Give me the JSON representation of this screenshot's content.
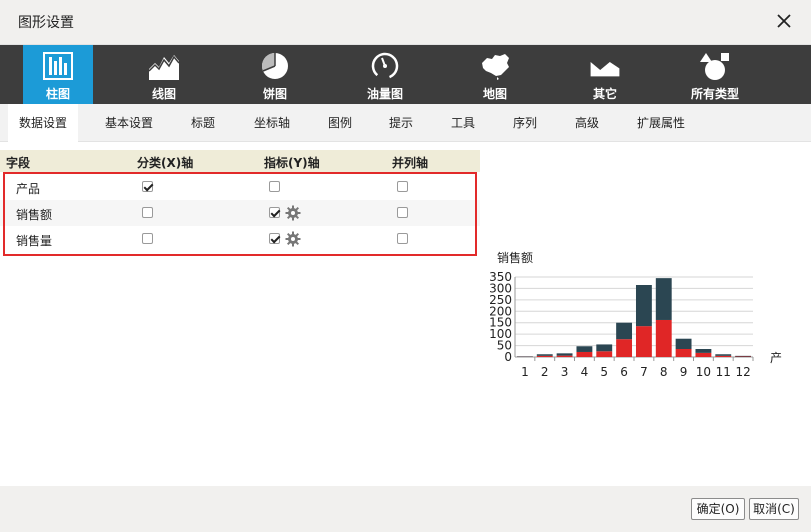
{
  "dialog": {
    "title": "图形设置"
  },
  "chart_types": [
    {
      "label": "柱图",
      "icon": "bar-chart-icon",
      "active": true
    },
    {
      "label": "线图",
      "icon": "line-chart-icon",
      "active": false
    },
    {
      "label": "饼图",
      "icon": "pie-chart-icon",
      "active": false
    },
    {
      "label": "油量图",
      "icon": "gauge-icon",
      "active": false
    },
    {
      "label": "地图",
      "icon": "map-icon",
      "active": false
    },
    {
      "label": "其它",
      "icon": "area-chart-icon",
      "active": false
    },
    {
      "label": "所有类型",
      "icon": "shapes-icon",
      "active": false
    }
  ],
  "tabs": [
    {
      "label": "数据设置",
      "active": true
    },
    {
      "label": "基本设置"
    },
    {
      "label": "标题"
    },
    {
      "label": "坐标轴"
    },
    {
      "label": "图例"
    },
    {
      "label": "提示"
    },
    {
      "label": "工具"
    },
    {
      "label": "序列"
    },
    {
      "label": "高级"
    },
    {
      "label": "扩展属性"
    }
  ],
  "fields": {
    "headers": {
      "field": "字段",
      "category_axis": "分类(X)轴",
      "metric_axis": "指标(Y)轴",
      "parallel_axis": "并列轴"
    },
    "rows": [
      {
        "name": "产品",
        "category": true,
        "metric": false,
        "parallel": false,
        "gear": false
      },
      {
        "name": "销售额",
        "category": false,
        "metric": true,
        "parallel": false,
        "gear": true
      },
      {
        "name": "销售量",
        "category": false,
        "metric": true,
        "parallel": false,
        "gear": true
      }
    ]
  },
  "preview": {
    "ylabel": "销售额",
    "xlabel": "产"
  },
  "chart_data": {
    "type": "bar",
    "stacked": true,
    "categories": [
      "1",
      "2",
      "3",
      "4",
      "5",
      "6",
      "7",
      "8",
      "9",
      "10",
      "11",
      "12"
    ],
    "series": [
      {
        "values": [
          1,
          5,
          6,
          22,
          25,
          78,
          135,
          162,
          35,
          18,
          5,
          2
        ],
        "color": "#e02626"
      },
      {
        "values": [
          2,
          7,
          10,
          25,
          30,
          72,
          180,
          183,
          45,
          17,
          7,
          3
        ],
        "color": "#2b4652"
      }
    ],
    "yticks": [
      0,
      50,
      100,
      150,
      200,
      250,
      300,
      350
    ],
    "ylim": [
      0,
      350
    ],
    "grid": true
  },
  "buttons": {
    "ok": "确定(O)",
    "cancel": "取消(C)"
  },
  "colors": {
    "accent": "#1c9bd7",
    "toolbar": "#3d3d3d",
    "highlight": "#e22a2a"
  }
}
